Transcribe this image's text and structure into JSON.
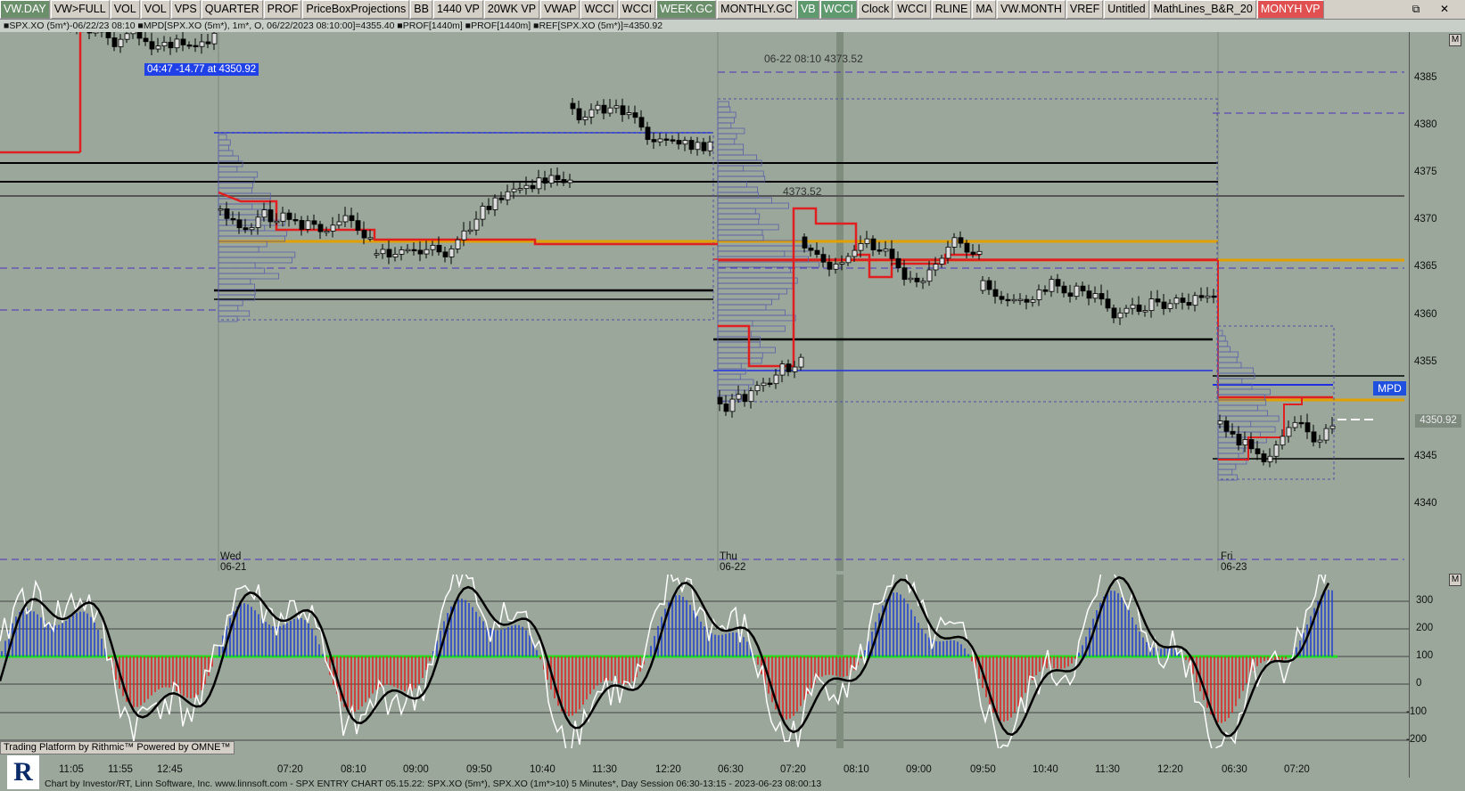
{
  "toolbar": {
    "buttons": [
      "VW.DAY",
      "VW>FULL",
      "VOL",
      "VOL",
      "VPS",
      "QUARTER",
      "PROF",
      "PriceBoxProjections",
      "BB",
      "1440 VP",
      "20WK VP",
      "VWAP",
      "WCCI",
      "WCCI",
      "WEEK.GC",
      "MONTHLY.GC",
      "VB",
      "WCCI",
      "Clock",
      "WCCI",
      "RLINE",
      "MA",
      "VW.MONTH",
      "VREF",
      "Untitled",
      "MathLines_B&R_20",
      "MONYH VP"
    ],
    "window_icons": [
      "⧉",
      "✕"
    ]
  },
  "infobar": {
    "text": "■SPX.XO (5m*)-06/22/23 08:10 ■MPD[SPX.XO (5m*), 1m*, O, 06/22/2023 08:10:00]=4355.40 ■PROF[1440m] ■PROF[1440m] ■REF[SPX.XO (5m*)]=4350.92"
  },
  "annotations": {
    "flag": "04:47  -14.77 at 4350.92",
    "high": "06-22 08:10  4373.52",
    "mid": "4373.52",
    "mpd": "MPD",
    "last_price": "4350.92"
  },
  "price_axis": {
    "labels": [
      "4385",
      "4380",
      "4375",
      "4370",
      "4365",
      "4360",
      "4355",
      "4345",
      "4340"
    ]
  },
  "osc_axis": {
    "labels": [
      "300",
      "200",
      "100",
      "0",
      "-100",
      "-200"
    ]
  },
  "time_axis": {
    "labels": [
      "11:05",
      "11:55",
      "12:45",
      "07:20",
      "08:10",
      "09:00",
      "09:50",
      "10:40",
      "11:30",
      "12:20",
      "06:30",
      "07:20",
      "08:10",
      "09:00",
      "09:50",
      "10:40",
      "11:30",
      "12:20",
      "06:30",
      "07:20"
    ]
  },
  "days": [
    {
      "name": "Wed",
      "date": "06-21"
    },
    {
      "name": "Thu",
      "date": "06-22"
    },
    {
      "name": "Fri",
      "date": "06-23"
    }
  ],
  "footer": {
    "rithmic": "Trading Platform by Rithmic™  Powered by OMNE™",
    "logo": "R",
    "credits": "Chart by Investor/RT, Linn Software, Inc. www.linnsoft.com - SPX ENTRY CHART   05.15.22: SPX.XO (5m*), SPX.XO (1m*>10) 5 Minutes*, Day Session 06:30-13:15 - 2023-06-23 08:00:13"
  },
  "colors": {
    "background": "#9aa79a",
    "vwap": "#e02020",
    "poc": "#e0a000",
    "level": "#000000",
    "mpd": "#2030e0",
    "bull_hist": "#2040d0",
    "bear_hist": "#e02020",
    "zero_line": "#20e020",
    "cci_fast": "#ffffff",
    "cci_slow": "#000000"
  }
}
